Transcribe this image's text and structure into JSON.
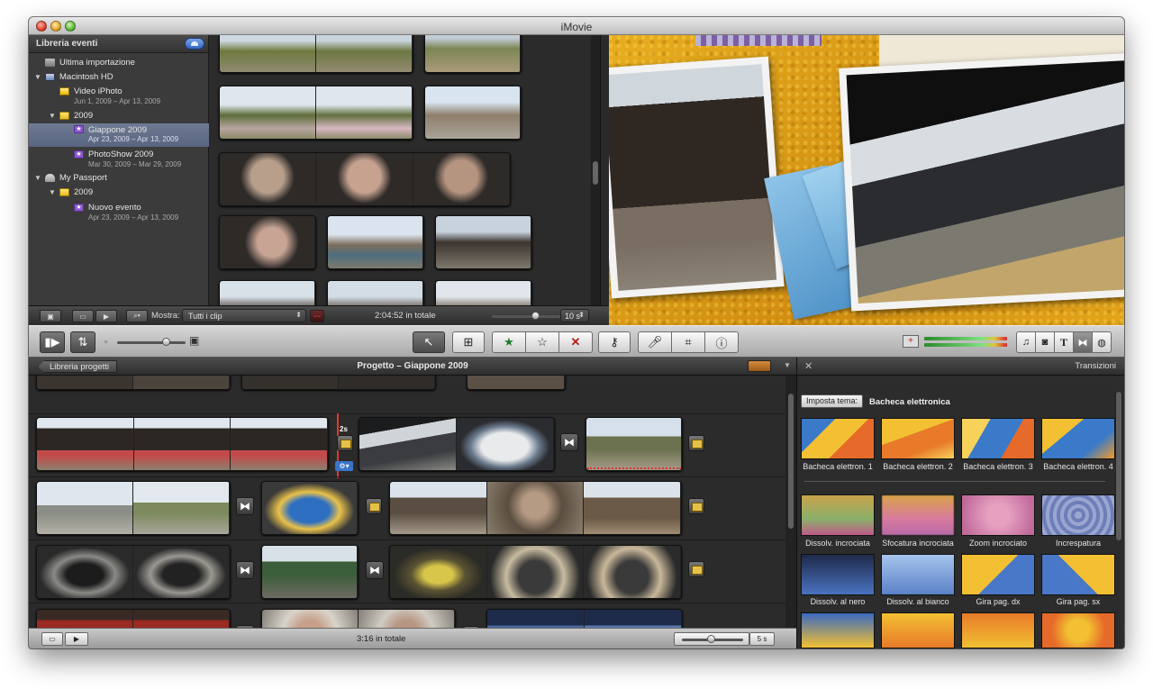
{
  "window": {
    "title": "iMovie"
  },
  "library": {
    "header": "Libreria eventi",
    "items": [
      {
        "label": "Ultima importazione",
        "dates": ""
      },
      {
        "label": "Macintosh HD",
        "dates": ""
      },
      {
        "label": "Video iPhoto",
        "dates": "Jun 1, 2009 – Apr 13, 2009"
      },
      {
        "label": "2009",
        "dates": ""
      },
      {
        "label": "Giappone 2009",
        "dates": "Apr 23, 2009 – Apr 13, 2009"
      },
      {
        "label": "PhotoShow 2009",
        "dates": "Mar 30, 2009 – Mar 29, 2009"
      },
      {
        "label": "My Passport",
        "dates": ""
      },
      {
        "label": "2009",
        "dates": ""
      },
      {
        "label": "Nuovo evento",
        "dates": "Apr 23, 2009 – Apr 13, 2009"
      }
    ]
  },
  "event_bar": {
    "show_label": "Mostra:",
    "show_value": "Tutti i clip",
    "total": "2:04:52 in totale",
    "zoom": "10 s"
  },
  "project": {
    "back_label": "Libreria progetti",
    "title": "Progetto – Giappone 2009",
    "playhead_label": "2s",
    "total": "3:16 in totale",
    "zoom": "5 s"
  },
  "transitions": {
    "panel_title": "Transizioni",
    "theme_button": "Imposta tema:",
    "theme_name": "Bacheca elettronica",
    "themed": [
      {
        "label": "Bacheca elettron. 1"
      },
      {
        "label": "Bacheca elettron. 2"
      },
      {
        "label": "Bacheca elettron. 3"
      },
      {
        "label": "Bacheca elettron. 4"
      }
    ],
    "standard": [
      {
        "label": "Dissolv. incrociata"
      },
      {
        "label": "Sfocatura incrociata"
      },
      {
        "label": "Zoom incrociato"
      },
      {
        "label": "Increspatura"
      },
      {
        "label": "Dissolv. al nero"
      },
      {
        "label": "Dissolv. al bianco"
      },
      {
        "label": "Gira pag. dx"
      },
      {
        "label": "Gira pag. sx"
      }
    ]
  },
  "colors": {
    "accent": "#596580",
    "playhead": "#e03a2a",
    "cork": "#d99d17"
  }
}
